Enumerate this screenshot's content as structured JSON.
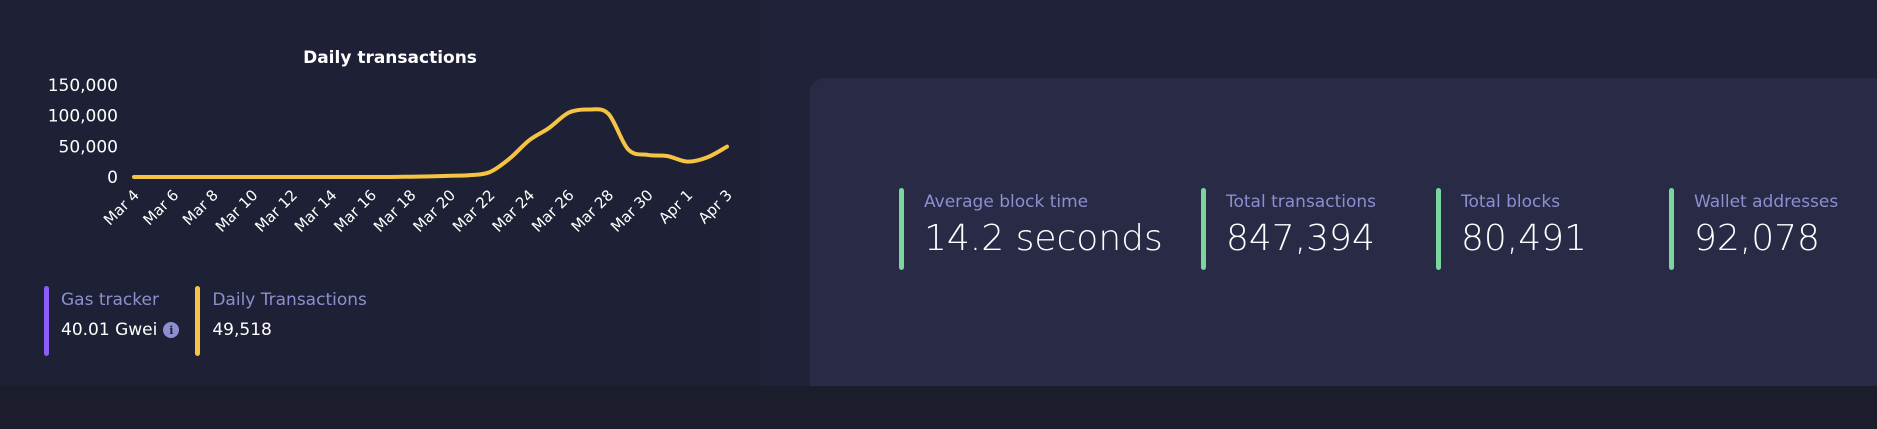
{
  "chart_data": {
    "type": "line",
    "title": "Daily transactions",
    "xlabel": "",
    "ylabel": "",
    "ylim": [
      0,
      150000
    ],
    "y_ticks": [
      "150,000",
      "100,000",
      "50,000",
      "0"
    ],
    "y_tick_values": [
      150000,
      100000,
      50000,
      0
    ],
    "x_tick_labels": [
      "Mar 4",
      "Mar 6",
      "Mar 8",
      "Mar 10",
      "Mar 12",
      "Mar 14",
      "Mar 16",
      "Mar 18",
      "Mar 20",
      "Mar 22",
      "Mar 24",
      "Mar 26",
      "Mar 28",
      "Mar 30",
      "Apr 1",
      "Apr 3"
    ],
    "x": [
      "Mar 4",
      "Mar 5",
      "Mar 6",
      "Mar 7",
      "Mar 8",
      "Mar 9",
      "Mar 10",
      "Mar 11",
      "Mar 12",
      "Mar 13",
      "Mar 14",
      "Mar 15",
      "Mar 16",
      "Mar 17",
      "Mar 18",
      "Mar 19",
      "Mar 20",
      "Mar 21",
      "Mar 22",
      "Mar 23",
      "Mar 24",
      "Mar 25",
      "Mar 26",
      "Mar 27",
      "Mar 28",
      "Mar 29",
      "Mar 30",
      "Mar 31",
      "Apr 1",
      "Apr 2",
      "Apr 3"
    ],
    "series": [
      {
        "color": "#f6c343",
        "values": [
          0,
          0,
          0,
          0,
          0,
          0,
          0,
          0,
          0,
          0,
          0,
          0,
          0,
          0,
          500,
          1000,
          2000,
          3000,
          8000,
          30000,
          60000,
          80000,
          105000,
          110000,
          103000,
          45000,
          36000,
          34000,
          25000,
          32000,
          49518
        ]
      }
    ],
    "grid": false,
    "legend": "none"
  },
  "mini_stats": [
    {
      "label": "Gas tracker",
      "value": "40.01 Gwei",
      "color": "#8b5cf6",
      "icon": "info-icon"
    },
    {
      "label": "Daily Transactions",
      "value": "49,518",
      "color": "#f6c343"
    }
  ],
  "stats": [
    {
      "label": "Average block time",
      "value": "14.2 seconds"
    },
    {
      "label": "Total transactions",
      "value": "847,394"
    },
    {
      "label": "Total blocks",
      "value": "80,491"
    },
    {
      "label": "Wallet addresses",
      "value": "92,078"
    }
  ],
  "colors": {
    "accent_stat": "#79d69d",
    "chart_line": "#f6c343"
  }
}
